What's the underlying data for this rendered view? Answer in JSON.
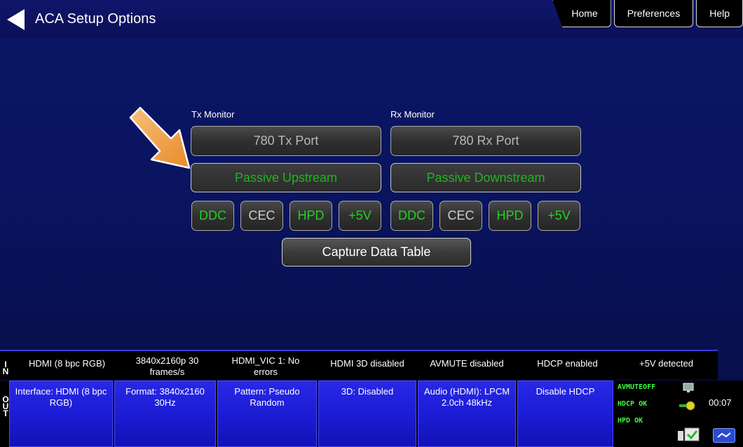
{
  "header": {
    "title": "ACA Setup Options",
    "tabs": [
      "Home",
      "Preferences",
      "Help"
    ]
  },
  "tx": {
    "label": "Tx Monitor",
    "port": "780 Tx Port",
    "passive": "Passive Upstream",
    "signals": [
      "DDC",
      "CEC",
      "HPD",
      "+5V"
    ]
  },
  "rx": {
    "label": "Rx Monitor",
    "port": "780 Rx Port",
    "passive": "Passive Downstream",
    "signals": [
      "DDC",
      "CEC",
      "HPD",
      "+5V"
    ]
  },
  "capture_label": "Capture Data Table",
  "in_strip": {
    "label": "IN",
    "cells": [
      "HDMI (8 bpc RGB)",
      "3840x2160p 30 frames/s",
      "HDMI_VIC 1: No errors",
      "HDMI 3D disabled",
      "AVMUTE disabled",
      "HDCP enabled",
      "+5V detected"
    ]
  },
  "out_strip": {
    "label": "OUT",
    "buttons": [
      "Interface: HDMI (8 bpc RGB)",
      "Format: 3840x2160 30Hz",
      "Pattern: Pseudo Random",
      "3D: Disabled",
      "Audio (HDMI): LPCM 2.0ch 48kHz",
      "Disable HDCP"
    ]
  },
  "status": {
    "avmute": "AVMUTEOFF",
    "hdcp": "HDCP OK",
    "hpd": "HPD OK",
    "clock": "00:07"
  },
  "colors": {
    "background": "#0a1460",
    "active_signal": "#1fd31f",
    "out_button": "#1a1ad0",
    "arrow": "#f5a04a"
  }
}
